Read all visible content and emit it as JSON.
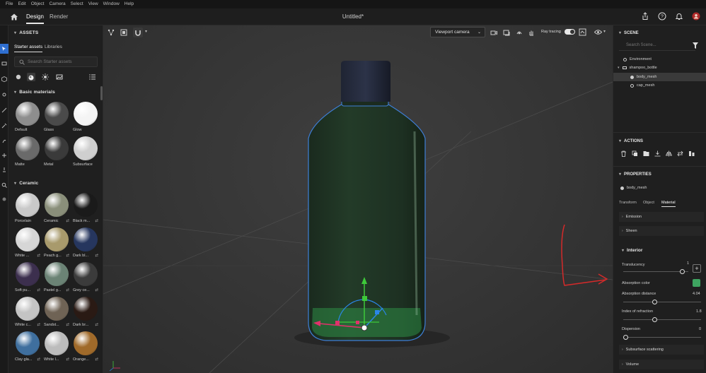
{
  "menu": [
    "File",
    "Edit",
    "Object",
    "Camera",
    "Select",
    "View",
    "Window",
    "Help"
  ],
  "header": {
    "tabs": [
      "Design",
      "Render"
    ],
    "active_tab": "Design",
    "document_title": "Untitled*"
  },
  "assets": {
    "title": "ASSETS",
    "tabs": [
      "Starter assets",
      "Libraries"
    ],
    "search_placeholder": "Search Starter assets",
    "sections": [
      {
        "name": "Basic materials",
        "items": [
          {
            "label": "Default",
            "color": "#8e8e8e"
          },
          {
            "label": "Glass",
            "color": "#4a4a4a"
          },
          {
            "label": "Glow",
            "color": "#f4f4f4"
          },
          {
            "label": "Matte",
            "color": "#6a6a6a"
          },
          {
            "label": "Metal",
            "color": "#3a3a3a"
          },
          {
            "label": "Subsurface",
            "color": "#cfcfcf"
          }
        ]
      },
      {
        "name": "Ceramic",
        "items": [
          {
            "label": "Porcelain",
            "color": "#c9c9c9",
            "dl": ""
          },
          {
            "label": "Ceramic",
            "color": "#8a8f7a",
            "dl": "⇄"
          },
          {
            "label": "Black m...",
            "color": "#1a1a1a",
            "dl": "⇄"
          },
          {
            "label": "White ...",
            "color": "#d6d6d6",
            "dl": "⇄"
          },
          {
            "label": "Peach g...",
            "color": "#a89a6c",
            "dl": "⇄"
          },
          {
            "label": "Dark bl...",
            "color": "#26365e",
            "dl": "⇄"
          },
          {
            "label": "Soft pu...",
            "color": "#3c2f4e",
            "dl": "⇄"
          },
          {
            "label": "Pastel g...",
            "color": "#6b8375",
            "dl": "⇄"
          },
          {
            "label": "Grey ce...",
            "color": "#3b3b3b",
            "dl": "⇄"
          },
          {
            "label": "White c...",
            "color": "#c4c4c4",
            "dl": "⇄"
          },
          {
            "label": "Sandst...",
            "color": "#6f6355",
            "dl": "⇄"
          },
          {
            "label": "Dark br...",
            "color": "#2a1a14",
            "dl": "⇄"
          },
          {
            "label": "Clay gla...",
            "color": "#3f6f9e",
            "dl": "⇄"
          },
          {
            "label": "White l...",
            "color": "#bcbcbc",
            "dl": "⇄"
          },
          {
            "label": "Orange...",
            "color": "#a06a2a",
            "dl": "⇄"
          }
        ]
      }
    ]
  },
  "viewport": {
    "camera": "Viewport camera",
    "ray_tracing_label": "Ray tracing",
    "ray_tracing_on": true
  },
  "scene": {
    "title": "SCENE",
    "search_placeholder": "Search Scene...",
    "items": [
      {
        "label": "Environment",
        "level": 0,
        "selected": false
      },
      {
        "label": "shampoo_bottle",
        "level": 0,
        "selected": false
      },
      {
        "label": "body_mesh",
        "level": 1,
        "selected": true
      },
      {
        "label": "cap_mesh",
        "level": 1,
        "selected": false
      }
    ]
  },
  "actions": {
    "title": "ACTIONS"
  },
  "properties": {
    "title": "PROPERTIES",
    "object_name": "body_mesh",
    "tabs": [
      "Transform",
      "Object",
      "Material"
    ],
    "active_tab": "Material",
    "collapsed_sections": [
      "Emission",
      "Sheen"
    ],
    "interior_title": "Interior",
    "translucency": {
      "label": "Translucency",
      "value": "1",
      "fraction": 0.94
    },
    "absorption_color": {
      "label": "Absorption color",
      "color": "#3ea460"
    },
    "absorption_distance": {
      "label": "Absorption distance",
      "value": "4.04",
      "fraction": 0.4
    },
    "ior": {
      "label": "Index of refraction",
      "value": "1.8",
      "fraction": 0.4
    },
    "dispersion": {
      "label": "Dispersion",
      "value": "0",
      "fraction": 0.0
    },
    "more_sections": [
      "Subsurface scattering",
      "Volume"
    ]
  }
}
